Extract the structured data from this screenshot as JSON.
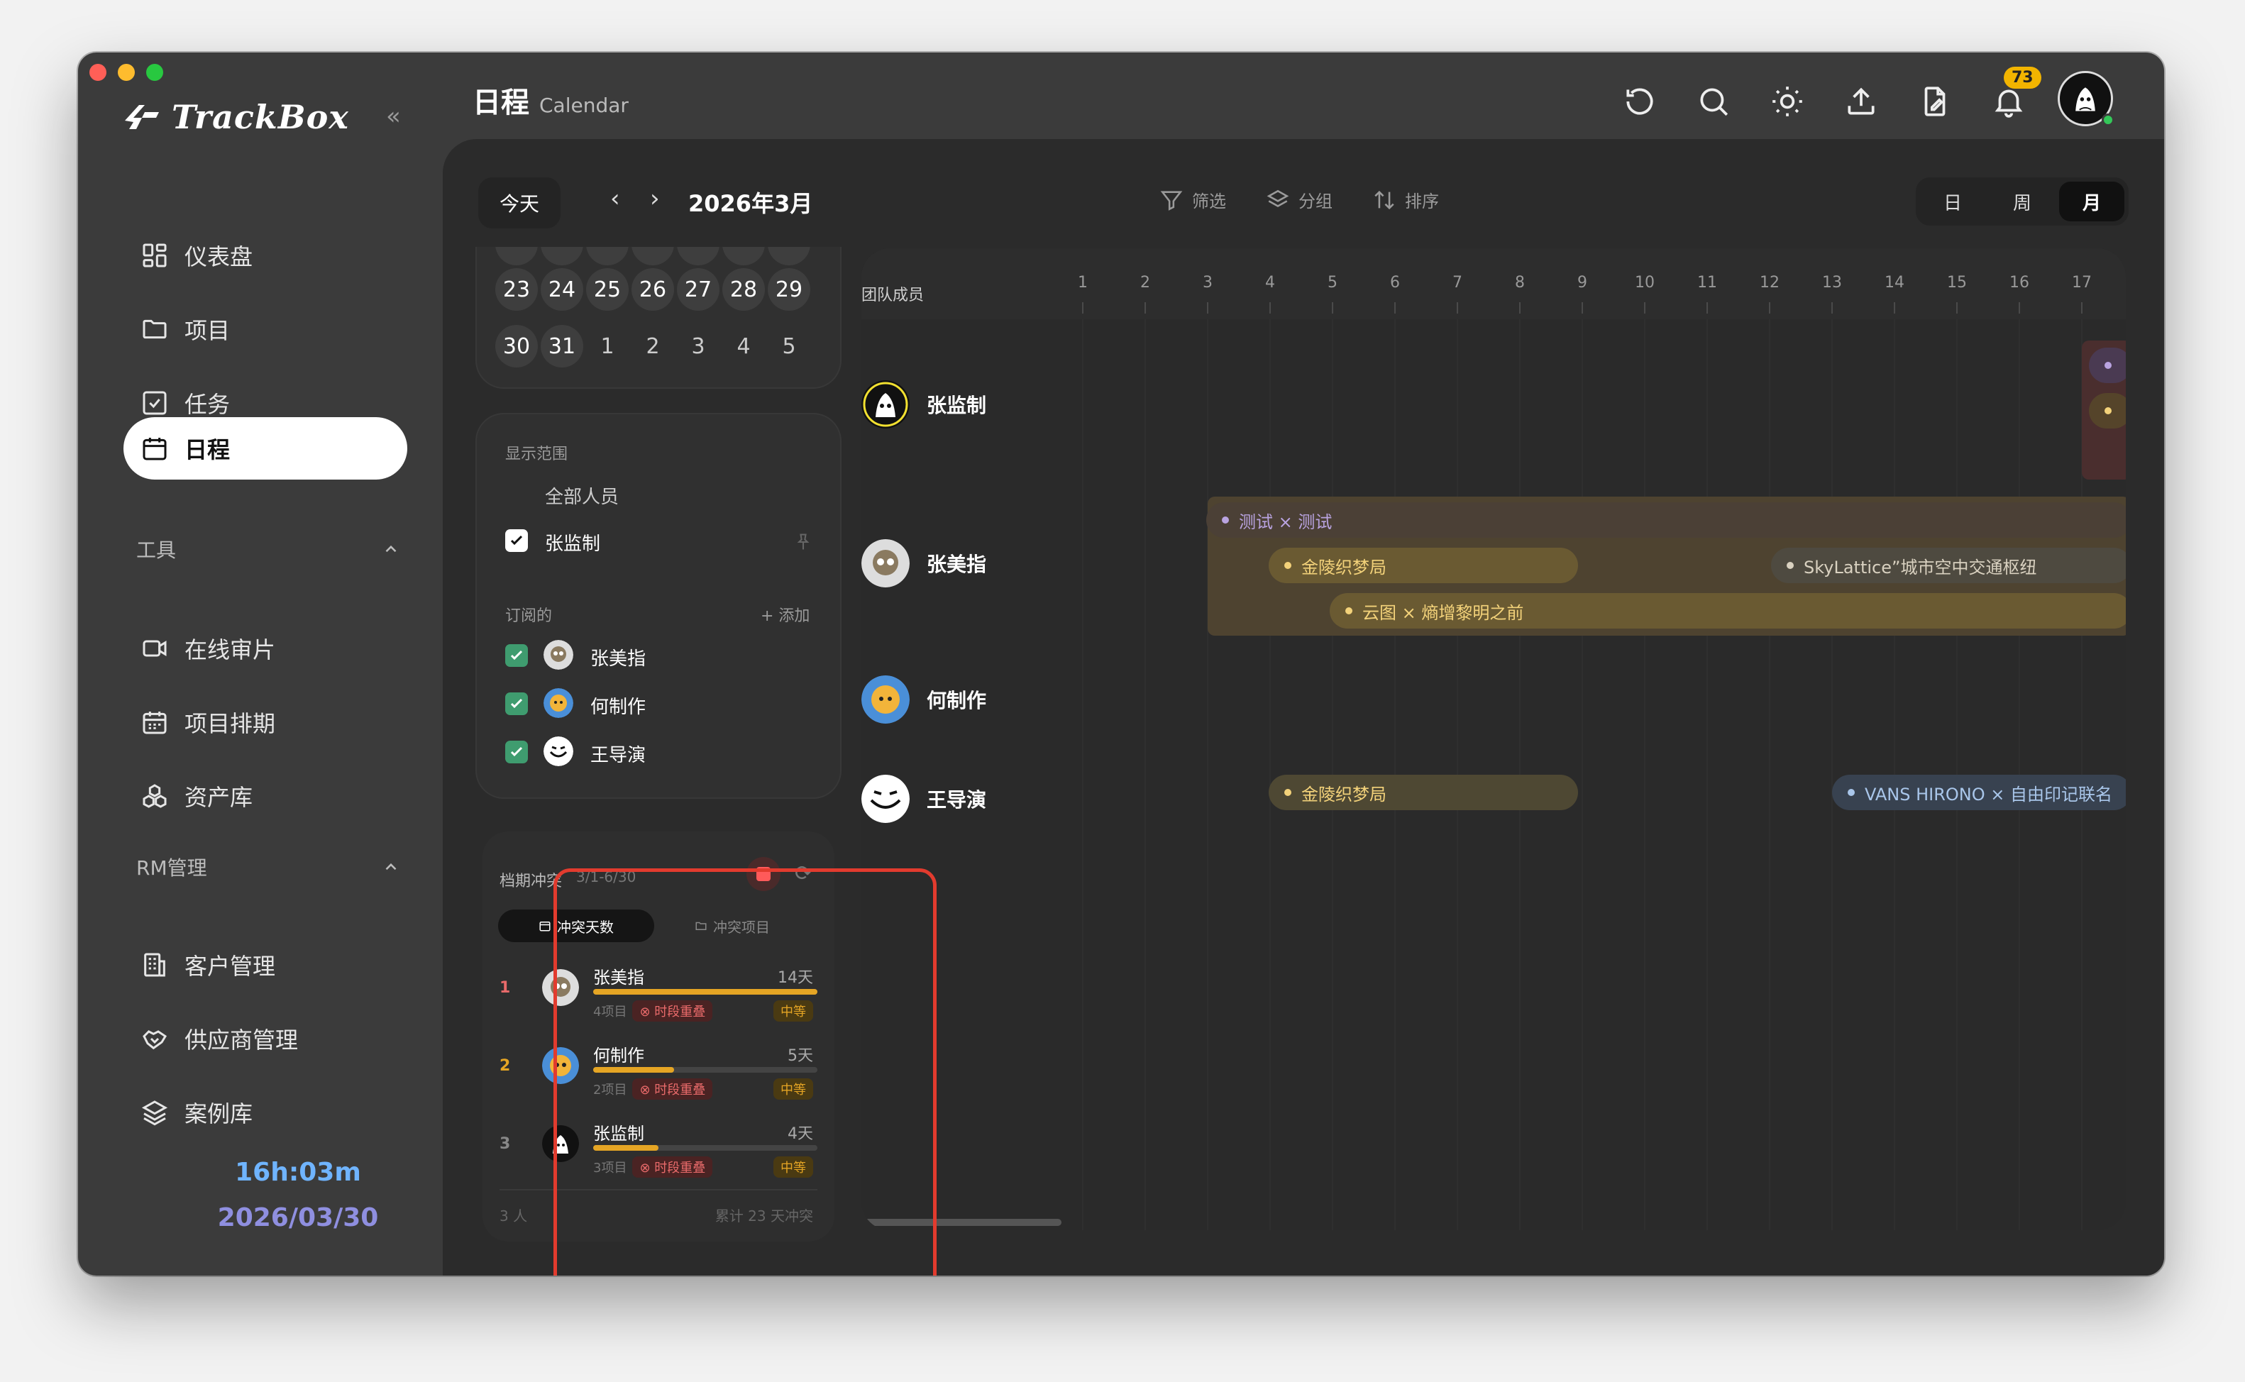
{
  "app": {
    "name": "TrackBox",
    "collapse_glyph": "«"
  },
  "sidebar": {
    "main_items": [
      {
        "label": "仪表盘",
        "icon": "dashboard-icon"
      },
      {
        "label": "项目",
        "icon": "folder-icon"
      },
      {
        "label": "任务",
        "icon": "task-check-icon"
      },
      {
        "label": "日程",
        "icon": "calendar-icon",
        "active": true
      }
    ],
    "sections": [
      {
        "label": "工具",
        "items": [
          {
            "label": "在线审片",
            "icon": "video-icon"
          },
          {
            "label": "项目排期",
            "icon": "schedule-icon"
          },
          {
            "label": "资产库",
            "icon": "assets-icon"
          }
        ]
      },
      {
        "label": "RM管理",
        "items": [
          {
            "label": "客户管理",
            "icon": "building-icon"
          },
          {
            "label": "供应商管理",
            "icon": "handshake-icon"
          },
          {
            "label": "案例库",
            "icon": "layers-icon"
          }
        ]
      }
    ],
    "clock": {
      "time": "16h:03m",
      "date": "2026/03/30"
    }
  },
  "header": {
    "title_cn": "日程",
    "title_en": "Calendar",
    "notification_count": "73",
    "icons": [
      "refresh-icon",
      "search-icon",
      "theme-sun-icon",
      "upload-icon",
      "file-edit-icon",
      "bell-icon"
    ]
  },
  "toolbar": {
    "today": "今天",
    "prev": "‹",
    "next": "›",
    "month": "2026年3月",
    "filter": "筛选",
    "group": "分组",
    "sort": "排序",
    "views": [
      "日",
      "周",
      "月"
    ],
    "active_view": "月"
  },
  "mini_calendar": {
    "rows": [
      [
        "23",
        "24",
        "25",
        "26",
        "27",
        "28",
        "29"
      ],
      [
        "30",
        "31",
        "1",
        "2",
        "3",
        "4",
        "5"
      ]
    ]
  },
  "scope": {
    "title": "显示范围",
    "all_people": "全部人员",
    "self": "张监制",
    "subscribed_label": "订阅的",
    "add_label": "+ 添加",
    "subscribed": [
      "张美指",
      "何制作",
      "王导演"
    ]
  },
  "conflict": {
    "title": "档期冲突",
    "range": "3/1-6/30",
    "tabs": [
      "冲突天数",
      "冲突项目"
    ],
    "rows": [
      {
        "rank": "1",
        "name": "张美指",
        "days": "14天",
        "projects": "4项目",
        "tag": "时段重叠",
        "level": "中等",
        "ratio": 1.0
      },
      {
        "rank": "2",
        "name": "何制作",
        "days": "5天",
        "projects": "2项目",
        "tag": "时段重叠",
        "level": "中等",
        "ratio": 0.36
      },
      {
        "rank": "3",
        "name": "张监制",
        "days": "4天",
        "projects": "3项目",
        "tag": "时段重叠",
        "level": "中等",
        "ratio": 0.29
      }
    ],
    "footer_people": "3 人",
    "footer_total": "累计 23 天冲突"
  },
  "timeline": {
    "team_label": "团队成员",
    "days": [
      "1",
      "2",
      "3",
      "4",
      "5",
      "6",
      "7",
      "8",
      "9",
      "10",
      "11",
      "12",
      "13",
      "14",
      "15",
      "16",
      "17"
    ],
    "members": [
      "张监制",
      "张美指",
      "何制作",
      "王导演"
    ],
    "events": {
      "test": "测试 × 测试",
      "jinling_1": "金陵织梦局",
      "skylattice": "SkyLattice”城市空中交通枢纽",
      "yuntu": "云图 × 熵增黎明之前",
      "jinling_2": "金陵织梦局",
      "vans": "VANS HIRONO × 自由印记联名"
    },
    "colors": {
      "purple": "#b9a3e0",
      "gold": "#f3d27a",
      "blue": "#a9c6ea"
    }
  }
}
